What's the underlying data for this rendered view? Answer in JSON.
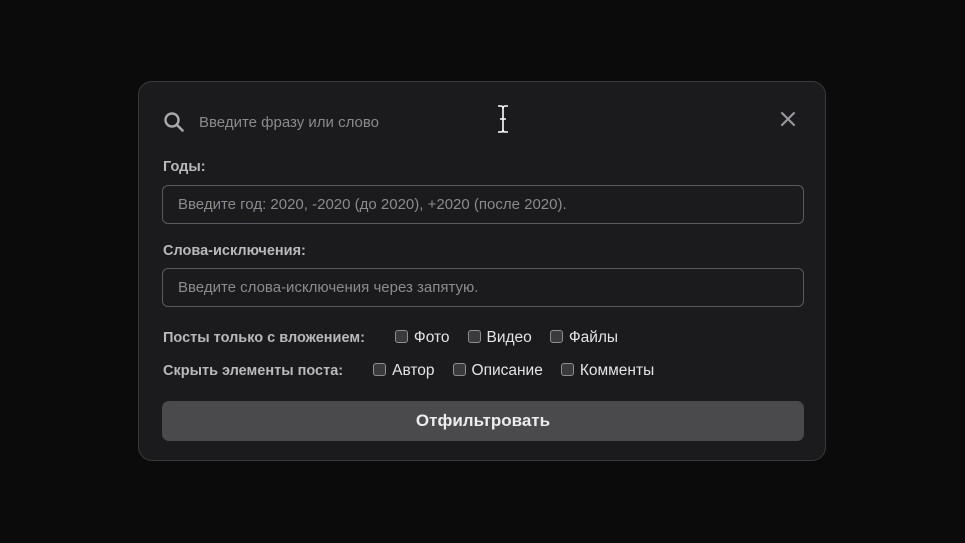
{
  "search": {
    "placeholder": "Введите фразу или слово",
    "icon": "search-icon",
    "close_icon": "close-icon"
  },
  "years": {
    "label": "Годы:",
    "placeholder": "Введите год: 2020, -2020 (до 2020), +2020 (после 2020)."
  },
  "exclusions": {
    "label": "Слова-исключения:",
    "placeholder": "Введите слова-исключения через запятую."
  },
  "attachments": {
    "label": "Посты только с вложением:",
    "options": [
      {
        "label": "Фото",
        "checked": false
      },
      {
        "label": "Видео",
        "checked": false
      },
      {
        "label": "Файлы",
        "checked": false
      }
    ]
  },
  "hide": {
    "label": "Скрыть элементы поста:",
    "options": [
      {
        "label": "Автор",
        "checked": false
      },
      {
        "label": "Описание",
        "checked": false
      },
      {
        "label": "Комменты",
        "checked": false
      }
    ]
  },
  "submit_label": "Отфильтровать",
  "colors": {
    "background": "#0b0b0b",
    "panel": "#1b1b1d",
    "button": "#4a4a4d"
  }
}
